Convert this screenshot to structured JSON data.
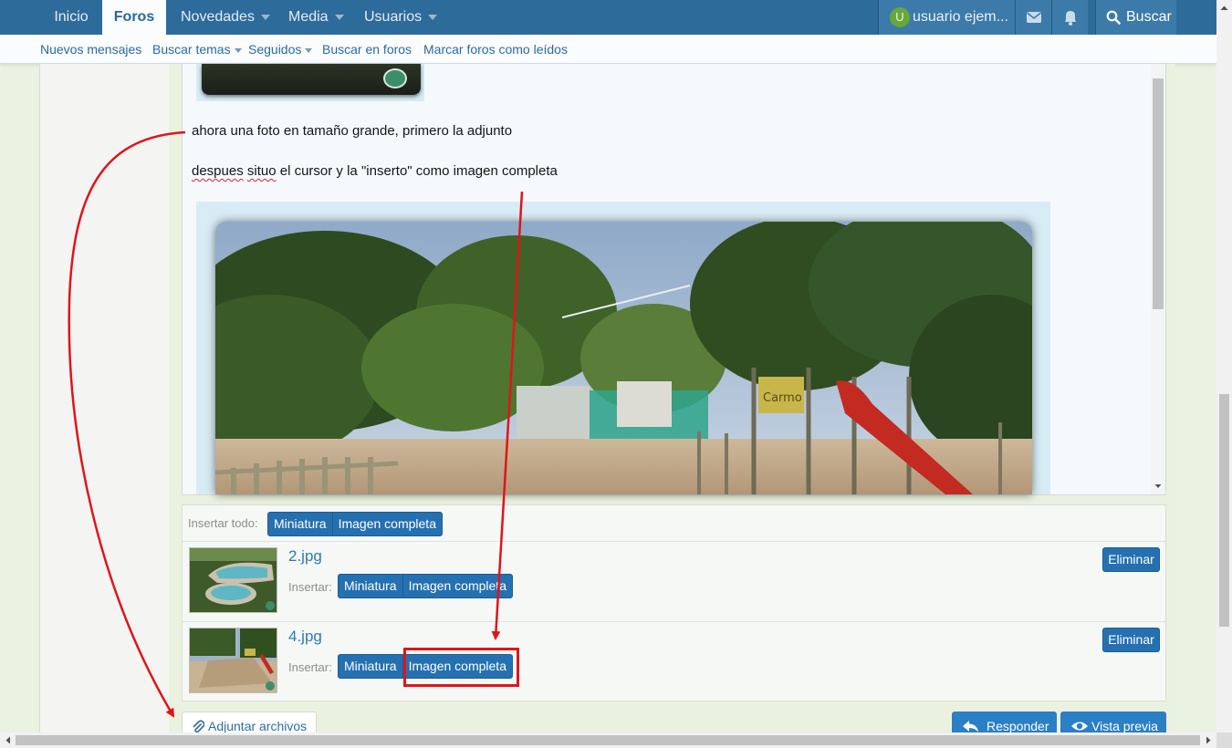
{
  "nav": {
    "tabs": [
      {
        "label": "Inicio",
        "dropdown": false,
        "active": false
      },
      {
        "label": "Foros",
        "dropdown": false,
        "active": true
      },
      {
        "label": "Novedades",
        "dropdown": true,
        "active": false
      },
      {
        "label": "Media",
        "dropdown": true,
        "active": false
      },
      {
        "label": "Usuarios",
        "dropdown": true,
        "active": false
      }
    ],
    "user": {
      "avatar_letter": "U",
      "name": "usuario ejem..."
    },
    "icons": [
      "envelope-icon",
      "bell-icon"
    ],
    "search_label": "Buscar"
  },
  "subnav": {
    "links": [
      {
        "label": "Nuevos mensajes",
        "dropdown": false
      },
      {
        "label": "Buscar temas",
        "dropdown": true
      },
      {
        "label": "Seguidos",
        "dropdown": true
      },
      {
        "label": "Buscar en foros",
        "dropdown": false
      },
      {
        "label": "Marcar foros como leídos",
        "dropdown": false
      }
    ]
  },
  "editor": {
    "line1": "ahora una foto en tamaño grande, primero la adjunto",
    "line2_misspelled": "despues",
    "line2_space": " ",
    "line2_misspelled2": "situo",
    "line2_rest": " el cursor y la \"inserto\" como imagen completa",
    "image_sign": "Carmo"
  },
  "attachments": {
    "insert_all_label": "Insertar todo:",
    "thumbnail_label": "Miniatura",
    "full_image_label": "Imagen completa",
    "insert_label": "Insertar:",
    "delete_label": "Eliminar",
    "files": [
      {
        "name": "2.jpg"
      },
      {
        "name": "4.jpg"
      }
    ]
  },
  "actions": {
    "attach_files": "Adjuntar archivos",
    "reply": "Responder",
    "preview": "Vista previa"
  },
  "colors": {
    "nav_bg": "#2d6b9b",
    "button_blue": "#2570b0",
    "annotation_red": "#e0141a",
    "form_bg": "#eaf2df"
  }
}
